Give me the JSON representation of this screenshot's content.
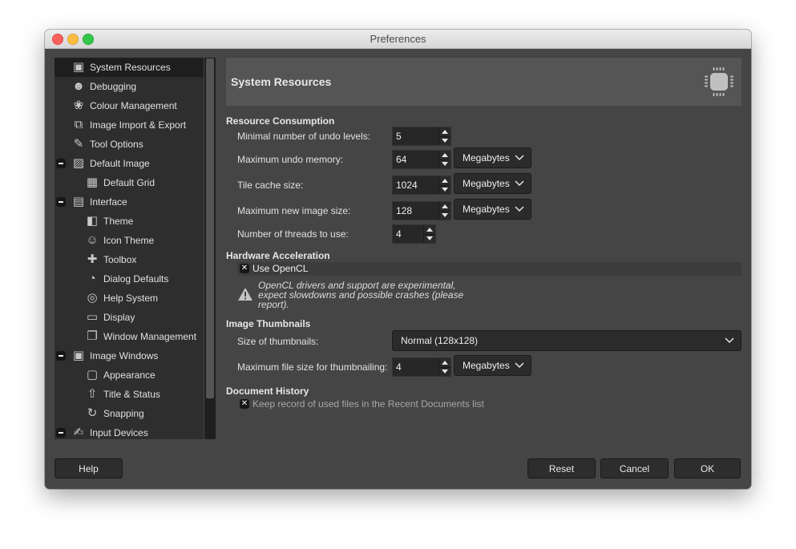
{
  "window": {
    "title": "Preferences"
  },
  "sidebar": {
    "items": [
      {
        "label": "System Resources",
        "icon": "cpu-chip-icon",
        "glyph": "▣",
        "level": 0,
        "selected": true,
        "expandable": false
      },
      {
        "label": "Debugging",
        "icon": "wilber-icon",
        "glyph": "☻",
        "level": 0,
        "selected": false,
        "expandable": false
      },
      {
        "label": "Colour Management",
        "icon": "colour-circles-icon",
        "glyph": "❀",
        "level": 0,
        "selected": false,
        "expandable": false
      },
      {
        "label": "Image Import & Export",
        "icon": "import-export-icon",
        "glyph": "⧉",
        "level": 0,
        "selected": false,
        "expandable": false
      },
      {
        "label": "Tool Options",
        "icon": "tool-options-icon",
        "glyph": "✎",
        "level": 0,
        "selected": false,
        "expandable": false
      },
      {
        "label": "Default Image",
        "icon": "default-image-icon",
        "glyph": "▨",
        "level": 0,
        "selected": false,
        "expandable": true
      },
      {
        "label": "Default Grid",
        "icon": "grid-icon",
        "glyph": "▦",
        "level": 1,
        "selected": false,
        "expandable": false
      },
      {
        "label": "Interface",
        "icon": "interface-icon",
        "glyph": "▤",
        "level": 0,
        "selected": false,
        "expandable": true
      },
      {
        "label": "Theme",
        "icon": "theme-palette-icon",
        "glyph": "◧",
        "level": 1,
        "selected": false,
        "expandable": false
      },
      {
        "label": "Icon Theme",
        "icon": "icon-theme-icon",
        "glyph": "☺",
        "level": 1,
        "selected": false,
        "expandable": false
      },
      {
        "label": "Toolbox",
        "icon": "toolbox-icon",
        "glyph": "✚",
        "level": 1,
        "selected": false,
        "expandable": false
      },
      {
        "label": "Dialog Defaults",
        "icon": "dialog-defaults-icon",
        "glyph": "◔",
        "level": 1,
        "selected": false,
        "expandable": false
      },
      {
        "label": "Help System",
        "icon": "lifebuoy-icon",
        "glyph": "◎",
        "level": 1,
        "selected": false,
        "expandable": false
      },
      {
        "label": "Display",
        "icon": "display-monitor-icon",
        "glyph": "▭",
        "level": 1,
        "selected": false,
        "expandable": false
      },
      {
        "label": "Window Management",
        "icon": "window-management-icon",
        "glyph": "❐",
        "level": 1,
        "selected": false,
        "expandable": false
      },
      {
        "label": "Image Windows",
        "icon": "image-window-icon",
        "glyph": "▣",
        "level": 0,
        "selected": false,
        "expandable": true
      },
      {
        "label": "Appearance",
        "icon": "appearance-ruler-icon",
        "glyph": "▢",
        "level": 1,
        "selected": false,
        "expandable": false
      },
      {
        "label": "Title & Status",
        "icon": "title-status-icon",
        "glyph": "⇧",
        "level": 1,
        "selected": false,
        "expandable": false
      },
      {
        "label": "Snapping",
        "icon": "snapping-icon",
        "glyph": "↻",
        "level": 1,
        "selected": false,
        "expandable": false
      },
      {
        "label": "Input Devices",
        "icon": "input-devices-icon",
        "glyph": "✍",
        "level": 0,
        "selected": false,
        "expandable": true
      }
    ]
  },
  "page": {
    "title": "System Resources",
    "icon": "cpu-chip-icon"
  },
  "resource_consumption": {
    "title": "Resource Consumption",
    "undo_levels": {
      "label": "Minimal number of undo levels:",
      "value": "5"
    },
    "undo_memory": {
      "label": "Maximum undo memory:",
      "value": "64",
      "unit": "Megabytes"
    },
    "tile_cache": {
      "label": "Tile cache size:",
      "value": "1024",
      "unit": "Megabytes"
    },
    "new_image_size": {
      "label": "Maximum new image size:",
      "value": "128",
      "unit": "Megabytes"
    },
    "threads": {
      "label": "Number of threads to use:",
      "value": "4"
    }
  },
  "hardware_acceleration": {
    "title": "Hardware Acceleration",
    "use_opencl": {
      "label": "Use OpenCL",
      "checked": true
    },
    "warning": "OpenCL drivers and support are experimental, expect slowdowns and possible crashes (please report)."
  },
  "image_thumbnails": {
    "title": "Image Thumbnails",
    "size": {
      "label": "Size of thumbnails:",
      "value": "Normal (128x128)"
    },
    "max_file_size": {
      "label": "Maximum file size for thumbnailing:",
      "value": "4",
      "unit": "Megabytes"
    }
  },
  "document_history": {
    "title": "Document History",
    "keep_record": {
      "label": "Keep record of used files in the Recent Documents list",
      "checked": true
    }
  },
  "buttons": {
    "help": "Help",
    "reset": "Reset",
    "cancel": "Cancel",
    "ok": "OK"
  },
  "check_glyph": "✕"
}
